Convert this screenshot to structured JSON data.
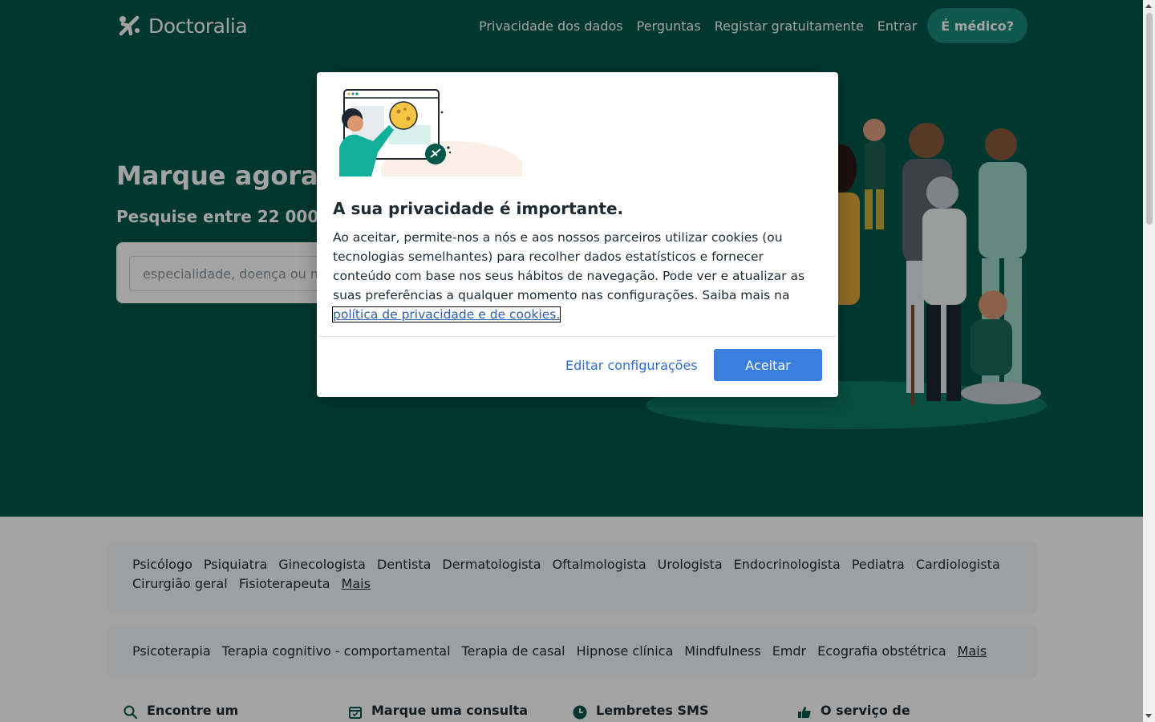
{
  "header": {
    "logo_text": "Doctoralia",
    "nav": [
      {
        "label": "Privacidade dos dados"
      },
      {
        "label": "Perguntas"
      },
      {
        "label": "Registar gratuitamente"
      },
      {
        "label": "Entrar"
      }
    ],
    "doctor_button": "É médico?"
  },
  "hero": {
    "title": "Marque agora",
    "subtitle": "Pesquise entre 22 000",
    "search_placeholder": "especialidade, doença ou n"
  },
  "specialties": {
    "items": [
      "Psicólogo",
      "Psiquiatra",
      "Ginecologista",
      "Dentista",
      "Dermatologista",
      "Oftalmologista",
      "Urologista",
      "Endocrinologista",
      "Pediatra",
      "Cardiologista",
      "Cirurgião geral",
      "Fisioterapeuta"
    ],
    "more": "Mais"
  },
  "services": {
    "items": [
      "Psicoterapia",
      "Terapia cognitivo - comportamental",
      "Terapia de casal",
      "Hipnose clínica",
      "Mindfulness",
      "Emdr",
      "Ecografia obstétrica"
    ],
    "more": "Mais"
  },
  "features": [
    {
      "title": "Encontre um",
      "icon": "search-icon"
    },
    {
      "title": "Marque uma consulta",
      "icon": "calendar-icon"
    },
    {
      "title": "Lembretes SMS",
      "icon": "clock-icon"
    },
    {
      "title": "O serviço de",
      "icon": "thumbs-up-icon"
    }
  ],
  "cookie_modal": {
    "title": "A sua privacidade é importante.",
    "body": "Ao aceitar, permite-nos a nós e aos nossos parceiros utilizar cookies (ou tecnologias semelhantes) para recolher dados estatísticos e fornecer conteúdo com base nos seus hábitos de navegação. Pode ver e atualizar as suas preferências a qualquer momento nas configurações. Saiba mais na ",
    "link_text": "política de privacidade e de cookies.",
    "edit_button": "Editar configurações",
    "accept_button": "Aceitar"
  },
  "colors": {
    "brand_green": "#00574a",
    "accent_blue": "#3a7fe0",
    "link_blue": "#2d6fcf"
  }
}
